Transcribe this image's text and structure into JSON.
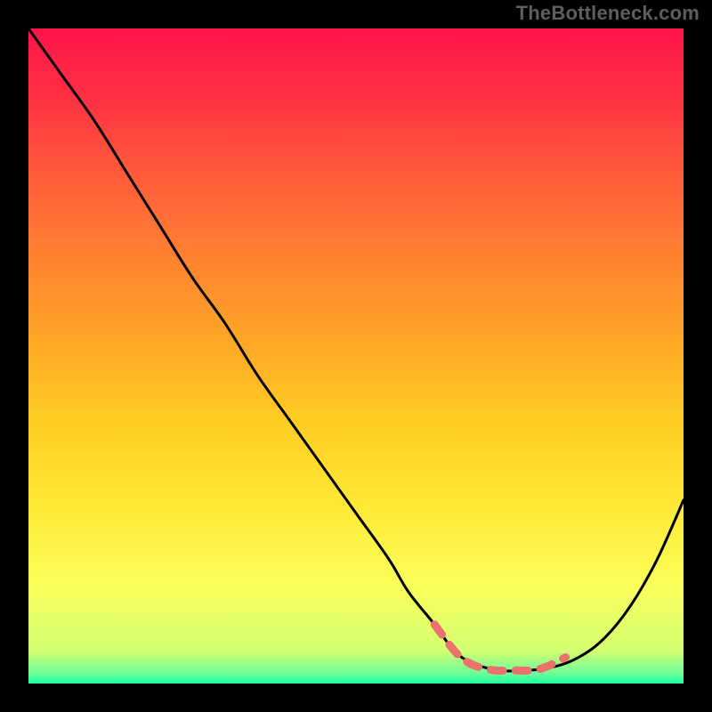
{
  "watermark": "TheBottleneck.com",
  "chart_data": {
    "type": "line",
    "title": "",
    "xlabel": "",
    "ylabel": "",
    "xlim": [
      0,
      100
    ],
    "ylim": [
      0,
      100
    ],
    "series": [
      {
        "name": "curve",
        "x": [
          0,
          5,
          10,
          15,
          20,
          25,
          30,
          35,
          40,
          45,
          50,
          55,
          58,
          62,
          65,
          68,
          72,
          76,
          80,
          84,
          88,
          92,
          96,
          100
        ],
        "values": [
          100,
          93,
          86,
          78,
          70,
          62,
          55,
          47,
          40,
          33,
          26,
          19,
          14,
          9,
          5,
          3,
          2,
          2,
          2.5,
          4,
          7,
          12,
          19,
          28
        ]
      }
    ],
    "markers": {
      "name": "dashed-highlight",
      "x": [
        62,
        66,
        70,
        74,
        78,
        82
      ],
      "values": [
        9,
        4,
        2.2,
        2.0,
        2.2,
        4
      ]
    },
    "gradient_stops": [
      {
        "offset": 0.0,
        "color": "#ff1449"
      },
      {
        "offset": 0.1,
        "color": "#ff2f44"
      },
      {
        "offset": 0.22,
        "color": "#ff5a3b"
      },
      {
        "offset": 0.35,
        "color": "#ff8230"
      },
      {
        "offset": 0.48,
        "color": "#ffa726"
      },
      {
        "offset": 0.6,
        "color": "#ffcd22"
      },
      {
        "offset": 0.72,
        "color": "#ffe733"
      },
      {
        "offset": 0.85,
        "color": "#fbff5a"
      },
      {
        "offset": 0.95,
        "color": "#d3ff72"
      },
      {
        "offset": 0.985,
        "color": "#6cff9a"
      },
      {
        "offset": 1.0,
        "color": "#18ffa0"
      }
    ],
    "curve_color": "#000000",
    "marker_color": "#e9726c"
  }
}
